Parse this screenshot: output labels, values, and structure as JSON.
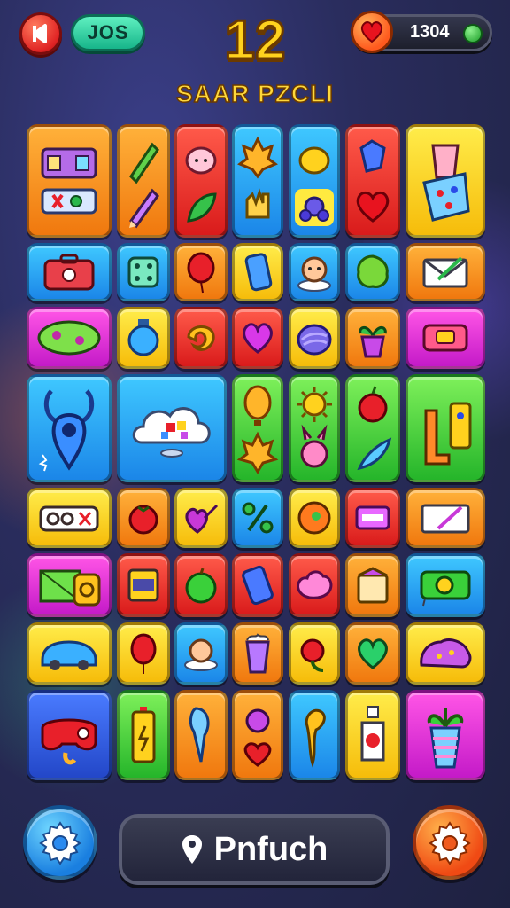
{
  "header": {
    "back_icon": "back-arrow-icon",
    "left_counter": "JOS",
    "level": "12",
    "score": "1304",
    "heart_icon": "heart-icon",
    "title": "SAAR PZCLI"
  },
  "footer": {
    "left_button_icon": "gear-icon",
    "right_button_icon": "gear-icon",
    "search_icon": "location-pin-icon",
    "search_label": "Pnfuch"
  },
  "colors": {
    "orange": "#f0780e",
    "red": "#d91b1b",
    "blue": "#1b86e8",
    "yellow": "#f6bc0a",
    "green": "#25b52a",
    "pink": "#c41ac8"
  },
  "board": {
    "tiles": [
      {
        "row": 1,
        "col": 1,
        "color": "orange",
        "icon": "toolbox-icon"
      },
      {
        "row": 1,
        "col": 2,
        "color": "orange",
        "icon": "pencil-icon"
      },
      {
        "row": 1,
        "col": 3,
        "color": "red",
        "icon": "face-leaf-icon"
      },
      {
        "row": 1,
        "col": 4,
        "color": "blue",
        "icon": "flame-hand-icon"
      },
      {
        "row": 1,
        "col": 5,
        "color": "blue",
        "icon": "lemon-bug-icon"
      },
      {
        "row": 1,
        "col": 6,
        "color": "red",
        "icon": "heart-gem-icon"
      },
      {
        "row": 1,
        "col": 7,
        "color": "yellow",
        "icon": "paint-cup-icon"
      },
      {
        "row": 2,
        "col": 1,
        "color": "blue",
        "icon": "suitcase-icon"
      },
      {
        "row": 2,
        "col": 2,
        "color": "blue",
        "icon": "dice-icon"
      },
      {
        "row": 2,
        "col": 3,
        "color": "orange",
        "icon": "balloon-icon"
      },
      {
        "row": 2,
        "col": 4,
        "color": "yellow",
        "icon": "phone-icon"
      },
      {
        "row": 2,
        "col": 5,
        "color": "blue",
        "icon": "baby-face-icon"
      },
      {
        "row": 2,
        "col": 6,
        "color": "blue",
        "icon": "leaf-blob-icon"
      },
      {
        "row": 2,
        "col": 7,
        "color": "orange",
        "icon": "envelope-icon"
      },
      {
        "row": 3,
        "col": 1,
        "color": "pink",
        "icon": "game-pad-icon"
      },
      {
        "row": 3,
        "col": 2,
        "color": "yellow",
        "icon": "lantern-icon"
      },
      {
        "row": 3,
        "col": 3,
        "color": "red",
        "icon": "croissant-icon"
      },
      {
        "row": 3,
        "col": 4,
        "color": "red",
        "icon": "heart-icon"
      },
      {
        "row": 3,
        "col": 5,
        "color": "yellow",
        "icon": "shell-icon"
      },
      {
        "row": 3,
        "col": 6,
        "color": "orange",
        "icon": "potted-plant-icon"
      },
      {
        "row": 3,
        "col": 7,
        "color": "pink",
        "icon": "camera-icon"
      },
      {
        "row": 4,
        "col": 1,
        "color": "blue",
        "icon": "map-pin-monster-icon"
      },
      {
        "row": 4,
        "col": 2,
        "color": "blue",
        "icon": "cloud-icon"
      },
      {
        "row": 4,
        "col": 3,
        "color": "green",
        "icon": "hot-air-balloon-icon"
      },
      {
        "row": 4,
        "col": 4,
        "color": "green",
        "icon": "sun-bunny-icon"
      },
      {
        "row": 4,
        "col": 5,
        "color": "green",
        "icon": "apple-feather-icon"
      },
      {
        "row": 4,
        "col": 6,
        "color": "green",
        "icon": "door-icon"
      },
      {
        "row": 5,
        "col": 1,
        "color": "yellow",
        "icon": "bus-icon"
      },
      {
        "row": 5,
        "col": 2,
        "color": "orange",
        "icon": "tomato-icon"
      },
      {
        "row": 5,
        "col": 3,
        "color": "yellow",
        "icon": "heart-arrow-icon"
      },
      {
        "row": 5,
        "col": 4,
        "color": "blue",
        "icon": "percent-icon"
      },
      {
        "row": 5,
        "col": 5,
        "color": "yellow",
        "icon": "orange-ball-icon"
      },
      {
        "row": 5,
        "col": 6,
        "color": "red",
        "icon": "radio-icon"
      },
      {
        "row": 5,
        "col": 7,
        "color": "orange",
        "icon": "letter-icon"
      },
      {
        "row": 6,
        "col": 1,
        "color": "pink",
        "icon": "camera-bag-icon"
      },
      {
        "row": 6,
        "col": 2,
        "color": "red",
        "icon": "oven-icon"
      },
      {
        "row": 6,
        "col": 3,
        "color": "red",
        "icon": "apple-icon"
      },
      {
        "row": 6,
        "col": 4,
        "color": "red",
        "icon": "smartphone-icon"
      },
      {
        "row": 6,
        "col": 5,
        "color": "red",
        "icon": "cloud-blob-icon"
      },
      {
        "row": 6,
        "col": 6,
        "color": "orange",
        "icon": "cake-box-icon"
      },
      {
        "row": 6,
        "col": 7,
        "color": "blue",
        "icon": "snail-icon"
      },
      {
        "row": 7,
        "col": 1,
        "color": "yellow",
        "icon": "van-icon"
      },
      {
        "row": 7,
        "col": 2,
        "color": "yellow",
        "icon": "red-balloon-icon"
      },
      {
        "row": 7,
        "col": 3,
        "color": "blue",
        "icon": "cloud-face-icon"
      },
      {
        "row": 7,
        "col": 4,
        "color": "orange",
        "icon": "popcorn-icon"
      },
      {
        "row": 7,
        "col": 5,
        "color": "yellow",
        "icon": "cherry-icon"
      },
      {
        "row": 7,
        "col": 6,
        "color": "orange",
        "icon": "green-heart-icon"
      },
      {
        "row": 7,
        "col": 7,
        "color": "yellow",
        "icon": "purple-blob-icon"
      },
      {
        "row": 8,
        "col": 1,
        "color": "blue",
        "icon": "gamepad-red-icon"
      },
      {
        "row": 8,
        "col": 2,
        "color": "green",
        "icon": "battery-icon"
      },
      {
        "row": 8,
        "col": 3,
        "color": "orange",
        "icon": "ice-cream-icon"
      },
      {
        "row": 8,
        "col": 4,
        "color": "orange",
        "icon": "heart-ornament-icon"
      },
      {
        "row": 8,
        "col": 5,
        "color": "blue",
        "icon": "flame-spoon-icon"
      },
      {
        "row": 8,
        "col": 6,
        "color": "yellow",
        "icon": "bottle-face-icon"
      },
      {
        "row": 8,
        "col": 7,
        "color": "pink",
        "icon": "cactus-cup-icon"
      }
    ]
  }
}
